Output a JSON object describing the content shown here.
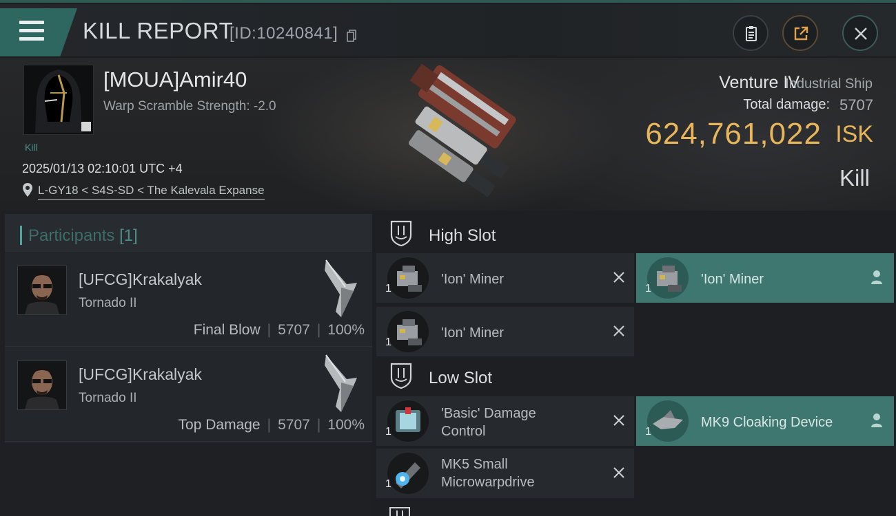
{
  "header": {
    "title": "KILL REPORT",
    "report_id": "[ID:10240841]"
  },
  "victim": {
    "name": "[MOUA]Amir40",
    "warp_scramble": "Warp Scramble Strength: -2.0",
    "kill_tag": "Kill",
    "datetime": "2025/01/13 02:10:01 UTC +4",
    "location": "L-GY18 < S4S-SD < The Kalevala Expanse"
  },
  "ship": {
    "name": "Venture IV",
    "class": "Industrial Ship",
    "total_damage_label": "Total damage:",
    "total_damage": "5707",
    "isk_value": "624,761,022",
    "isk_unit": "ISK",
    "result": "Kill"
  },
  "participants": {
    "label": "Participants",
    "count": "[1]",
    "rows": [
      {
        "name": "[UFCG]Krakalyak",
        "ship": "Tornado II",
        "role": "Final Blow",
        "damage": "5707",
        "percent": "100%"
      },
      {
        "name": "[UFCG]Krakalyak",
        "ship": "Tornado II",
        "role": "Top Damage",
        "damage": "5707",
        "percent": "100%"
      }
    ]
  },
  "fitting": {
    "high_slot": {
      "label": "High Slot",
      "modules": [
        {
          "name": "'Ion' Miner",
          "qty": "1",
          "state": "destroyed"
        },
        {
          "name": "'Ion' Miner",
          "qty": "1",
          "state": "dropped"
        },
        {
          "name": "'Ion' Miner",
          "qty": "1",
          "state": "destroyed"
        }
      ]
    },
    "low_slot": {
      "label": "Low Slot",
      "modules": [
        {
          "name_line1": "'Basic' Damage",
          "name_line2": "Control",
          "qty": "1",
          "state": "destroyed"
        },
        {
          "name": "MK9 Cloaking Device",
          "qty": "1",
          "state": "dropped"
        },
        {
          "name_line1": "MK5 Small",
          "name_line2": "Microwarpdrive",
          "qty": "1",
          "state": "destroyed"
        }
      ]
    }
  },
  "colors": {
    "accent": "#2e6660",
    "isk": "#e8b65a",
    "fitted": "#3d7770"
  },
  "icons": [
    "menu-icon",
    "copy-icon",
    "clipboard-icon",
    "share-icon",
    "close-icon",
    "location-pin-icon",
    "slot-icon",
    "remove-x-icon",
    "person-icon"
  ]
}
